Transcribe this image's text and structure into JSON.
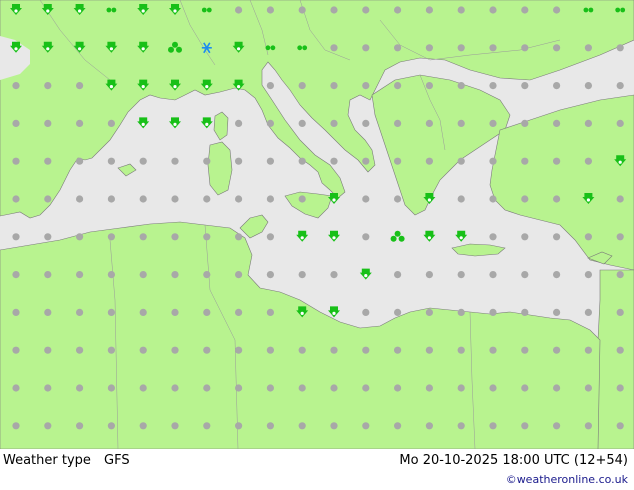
{
  "map": {
    "colors": {
      "land": "#b8f38f",
      "sea": "#e8e8e8",
      "border": "#9a9a9a",
      "coast": "#7a7a7a",
      "dot": "#a8a8a8",
      "rain": "#18c018",
      "snow": "#1e8cf0"
    },
    "grid_columns": 20,
    "grid_rows": 12,
    "legend": {
      "dot_symbol": "no-precipitation-dot",
      "rain_symbol": "rain-shower-icon",
      "snow_symbol": "snow-icon",
      "drizzle_symbol": "drizzle-icon"
    },
    "precip_cells": [
      [
        0,
        0,
        "rain"
      ],
      [
        1,
        0,
        "rain"
      ],
      [
        2,
        0,
        "rain"
      ],
      [
        3,
        0,
        "drizzle"
      ],
      [
        4,
        0,
        "rain"
      ],
      [
        5,
        0,
        "rain"
      ],
      [
        6,
        0,
        "drizzle"
      ],
      [
        18,
        0,
        "drizzle"
      ],
      [
        19,
        0,
        "drizzle"
      ],
      [
        0,
        1,
        "rain"
      ],
      [
        1,
        1,
        "rain"
      ],
      [
        2,
        1,
        "rain"
      ],
      [
        3,
        1,
        "rain"
      ],
      [
        4,
        1,
        "rain"
      ],
      [
        5,
        1,
        "shower"
      ],
      [
        6,
        1,
        "snow"
      ],
      [
        7,
        1,
        "rain"
      ],
      [
        8,
        1,
        "drizzle"
      ],
      [
        9,
        1,
        "drizzle"
      ],
      [
        3,
        2,
        "rain"
      ],
      [
        4,
        2,
        "rain"
      ],
      [
        5,
        2,
        "rain"
      ],
      [
        6,
        2,
        "rain"
      ],
      [
        7,
        2,
        "rain"
      ],
      [
        4,
        3,
        "rain"
      ],
      [
        5,
        3,
        "rain"
      ],
      [
        6,
        3,
        "rain"
      ],
      [
        10,
        5,
        "rain"
      ],
      [
        13,
        5,
        "rain"
      ],
      [
        18,
        5,
        "rain"
      ],
      [
        19,
        4,
        "rain"
      ],
      [
        9,
        6,
        "rain"
      ],
      [
        10,
        6,
        "rain"
      ],
      [
        12,
        6,
        "shower"
      ],
      [
        13,
        6,
        "rain"
      ],
      [
        14,
        6,
        "rain"
      ],
      [
        11,
        7,
        "rain"
      ],
      [
        9,
        8,
        "rain"
      ],
      [
        10,
        8,
        "rain"
      ]
    ]
  },
  "footer": {
    "title": "Weather type",
    "model": "GFS",
    "datetime": "Mo 20-10-2025 18:00 UTC (12+54)",
    "credit": "©weatheronline.co.uk"
  }
}
